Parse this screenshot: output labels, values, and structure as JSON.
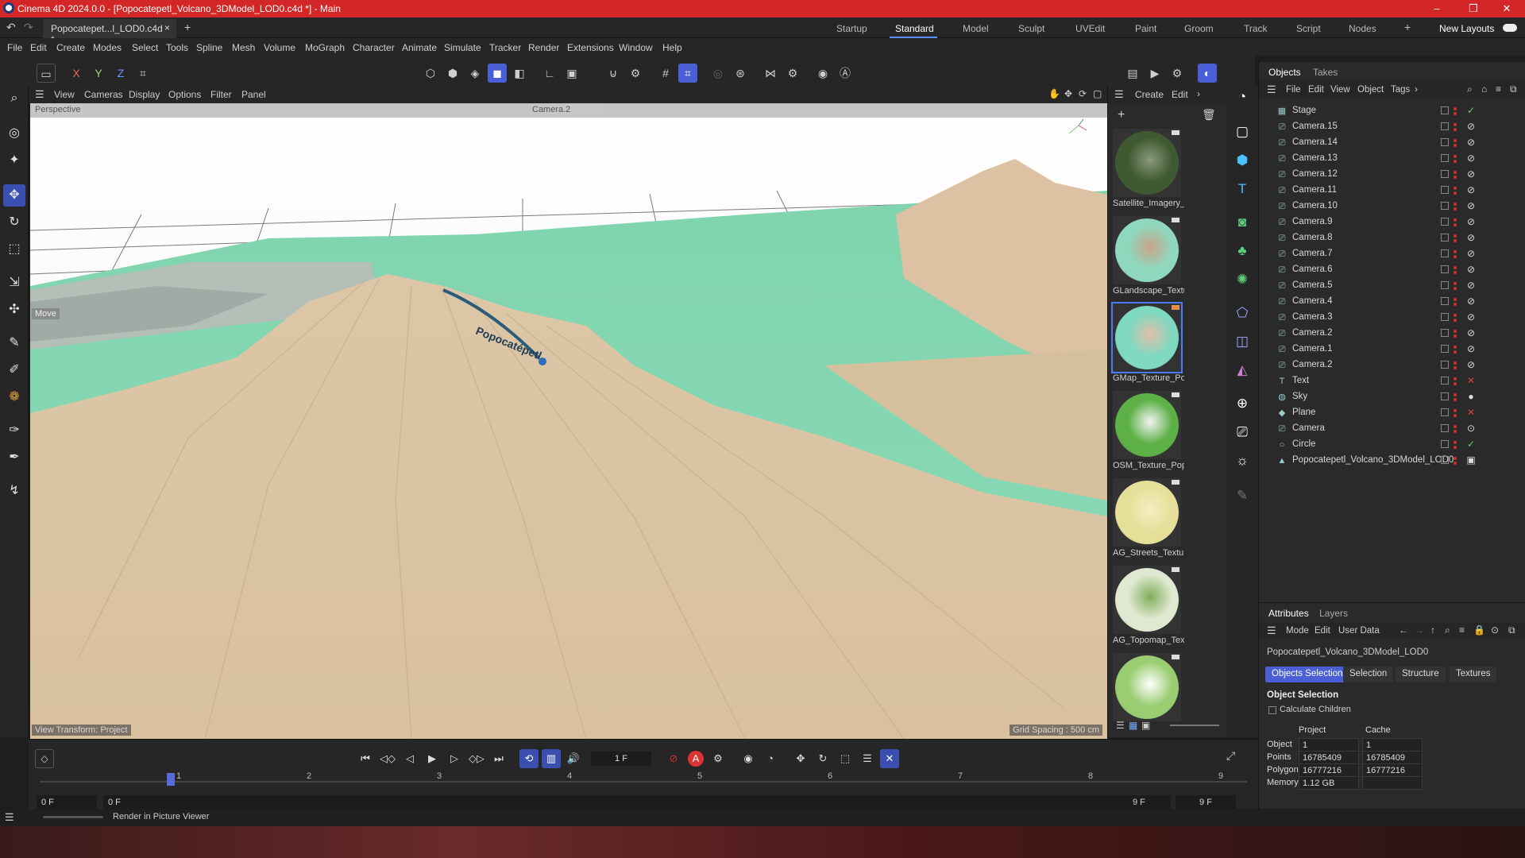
{
  "window": {
    "title": "Cinema 4D 2024.0.0 - [Popocatepetl_Volcano_3DModel_LOD0.c4d *] - Main",
    "controls": [
      "–",
      "❐",
      "✕"
    ]
  },
  "doc_tab": {
    "label": "Popocatepet...l_LOD0.c4d *",
    "close": "×",
    "add": "+"
  },
  "layouts": [
    "Startup",
    "Standard",
    "Model",
    "Sculpt",
    "UVEdit",
    "Paint",
    "Groom",
    "Track",
    "Script",
    "Nodes"
  ],
  "layouts_active": "Standard",
  "new_layouts": "New Layouts",
  "menu": [
    "File",
    "Edit",
    "Create",
    "Modes",
    "Select",
    "Tools",
    "Spline",
    "Mesh",
    "Volume",
    "MoGraph",
    "Character",
    "Animate",
    "Simulate",
    "Tracker",
    "Render",
    "Extensions",
    "Window",
    "Help"
  ],
  "axes": {
    "x": "X",
    "y": "Y",
    "z": "Z"
  },
  "viewport": {
    "menu": [
      "View",
      "Cameras",
      "Display",
      "Options",
      "Filter",
      "Panel"
    ],
    "perspective_label": "Perspective",
    "camera_label": "Camera.2",
    "move_label": "Move",
    "view_transform": "View Transform: Project",
    "grid_spacing": "Grid Spacing : 500 cm",
    "terrain_label": "Popocatépetl"
  },
  "material_manager": {
    "menu": [
      "Create",
      "Edit"
    ],
    "materials": [
      {
        "name": "Satellite_Imagery_",
        "color": "#3f5a32",
        "accent": "#8a9a7a",
        "selected": false
      },
      {
        "name": "GLandscape_Textu",
        "color": "#8fd8bd",
        "accent": "#c9a48a",
        "selected": false
      },
      {
        "name": "GMap_Texture_Po",
        "color": "#7fd9c0",
        "accent": "#e0c0a8",
        "selected": true
      },
      {
        "name": "OSM_Texture_Pop",
        "color": "#5cb046",
        "accent": "#f4f4f4",
        "selected": false
      },
      {
        "name": "AG_Streets_Textur",
        "color": "#e6df9a",
        "accent": "#f4efc0",
        "selected": false
      },
      {
        "name": "AG_Topomap_Tex",
        "color": "#dfe8d0",
        "accent": "#7fae5a",
        "selected": false
      },
      {
        "name": "",
        "color": "#9acd72",
        "accent": "#ffffff",
        "selected": false
      }
    ]
  },
  "objects_panel": {
    "tabs": [
      "Objects",
      "Takes"
    ],
    "menu": [
      "File",
      "Edit",
      "View",
      "Object",
      "Tags"
    ],
    "rows": [
      {
        "name": "Stage",
        "icon": "▦",
        "tag": "✓"
      },
      {
        "name": "Camera.15",
        "icon": "🎥",
        "tag": "⊘"
      },
      {
        "name": "Camera.14",
        "icon": "🎥",
        "tag": "⊘"
      },
      {
        "name": "Camera.13",
        "icon": "🎥",
        "tag": "⊘"
      },
      {
        "name": "Camera.12",
        "icon": "🎥",
        "tag": "⊘"
      },
      {
        "name": "Camera.11",
        "icon": "🎥",
        "tag": "⊘"
      },
      {
        "name": "Camera.10",
        "icon": "🎥",
        "tag": "⊘"
      },
      {
        "name": "Camera.9",
        "icon": "🎥",
        "tag": "⊘"
      },
      {
        "name": "Camera.8",
        "icon": "🎥",
        "tag": "⊘"
      },
      {
        "name": "Camera.7",
        "icon": "🎥",
        "tag": "⊘"
      },
      {
        "name": "Camera.6",
        "icon": "🎥",
        "tag": "⊘"
      },
      {
        "name": "Camera.5",
        "icon": "🎥",
        "tag": "⊘"
      },
      {
        "name": "Camera.4",
        "icon": "🎥",
        "tag": "⊘"
      },
      {
        "name": "Camera.3",
        "icon": "🎥",
        "tag": "⊘"
      },
      {
        "name": "Camera.2",
        "icon": "🎥",
        "tag": "⊘"
      },
      {
        "name": "Camera.1",
        "icon": "🎥",
        "tag": "⊘"
      },
      {
        "name": "Camera.2",
        "icon": "🎥",
        "tag": "⊘"
      },
      {
        "name": "Text",
        "icon": "T",
        "tag": "✕"
      },
      {
        "name": "Sky",
        "icon": "◍",
        "tag": "●"
      },
      {
        "name": "Plane",
        "icon": "◆",
        "tag": "✕"
      },
      {
        "name": "Camera",
        "icon": "🎥",
        "tag": "⊙"
      },
      {
        "name": "Circle",
        "icon": "○",
        "tag": "✓"
      },
      {
        "name": "Popocatepetl_Volcano_3DModel_LOD0",
        "icon": "▲",
        "tag": "▣"
      }
    ]
  },
  "attributes": {
    "tabs": [
      "Attributes",
      "Layers"
    ],
    "menu": [
      "Mode",
      "Edit",
      "User Data"
    ],
    "object_name": "Popocatepetl_Volcano_3DModel_LOD0",
    "buttons": [
      "Objects Selection",
      "Selection",
      "Structure",
      "Textures"
    ],
    "section": "Object Selection",
    "checkbox_label": "Calculate Children",
    "col_project": "Project",
    "col_cache": "Cache",
    "rows": [
      {
        "label": "Object",
        "project": "1",
        "cache": "1"
      },
      {
        "label": "Points",
        "project": "16785409",
        "cache": "16785409"
      },
      {
        "label": "Polygons",
        "project": "16777216",
        "cache": "16777216"
      },
      {
        "label": "Memory",
        "project": "1.12 GB",
        "cache": ""
      }
    ]
  },
  "timeline": {
    "current_frame": "1 F",
    "ticks": [
      "1",
      "2",
      "3",
      "4",
      "5",
      "6",
      "7",
      "8",
      "9"
    ],
    "start_left": "0 F",
    "start_right": "0 F",
    "end_left": "9 F",
    "end_right": "9 F",
    "play_buttons": [
      "⏮",
      "◁◇",
      "◁",
      "▶",
      "▷",
      "◇▷",
      "⏭"
    ]
  },
  "status": {
    "text": "Render in Picture Viewer"
  }
}
